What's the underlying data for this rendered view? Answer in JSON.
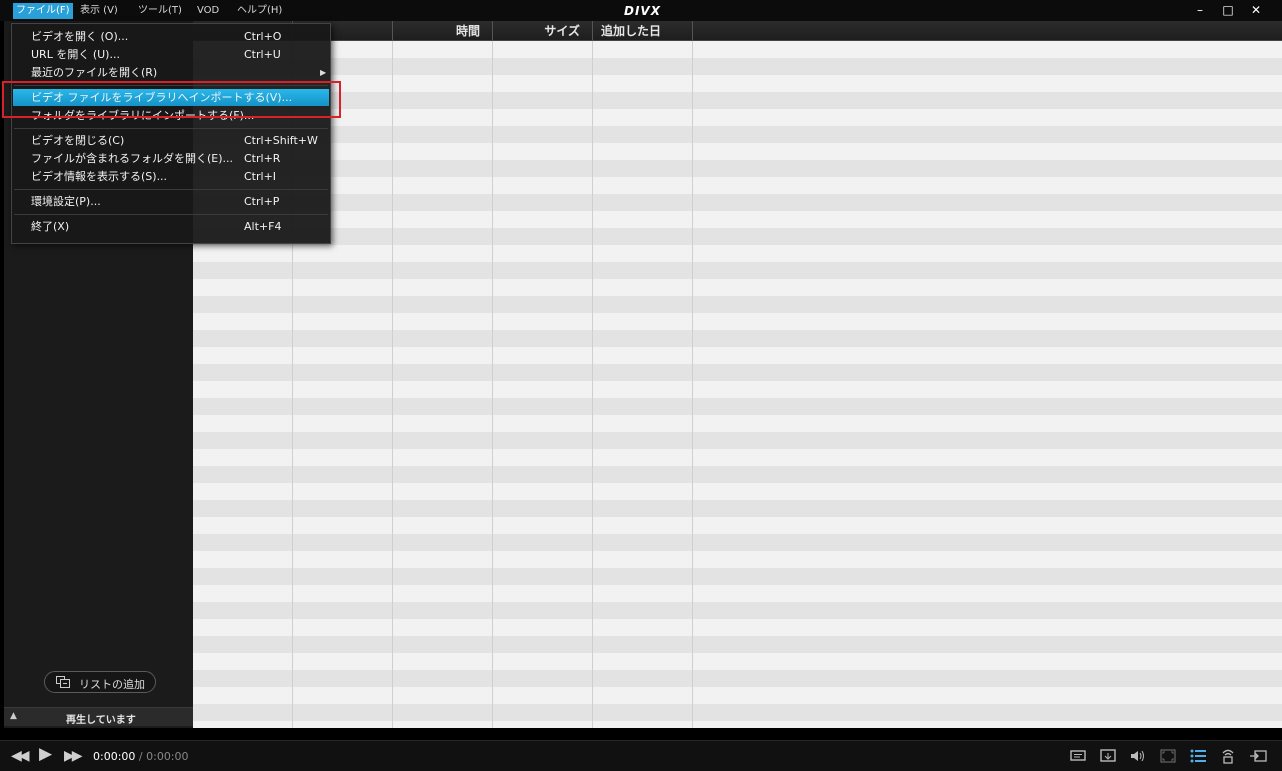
{
  "menubar": {
    "file": "ファイル(F)",
    "view": "表示 (V)",
    "tools": "ツール(T)",
    "vod": "VOD",
    "help": "ヘルプ(H)"
  },
  "app": {
    "logo": "DIVX"
  },
  "window_controls": {
    "minimize": "–",
    "maximize": "□",
    "close": "✕"
  },
  "table": {
    "columns": [
      "",
      "",
      "時間",
      "サイズ",
      "追加した日"
    ]
  },
  "sidebar": {
    "add_list_label": "リストの追加",
    "now_playing_label": "再生しています",
    "collapse_glyph": "▲"
  },
  "file_menu": {
    "items": [
      {
        "label": "ビデオを開く (O)...",
        "shortcut": "Ctrl+O"
      },
      {
        "label": "URL を開く (U)...",
        "shortcut": "Ctrl+U"
      },
      {
        "label": "最近のファイルを開く(R)",
        "shortcut": "",
        "submenu": "▶"
      },
      {
        "label": "ビデオ ファイルをライブラリへインポートする(V)...",
        "shortcut": ""
      },
      {
        "label": "フォルダをライブラリにインポートする(F)...",
        "shortcut": ""
      },
      {
        "label": "ビデオを閉じる(C)",
        "shortcut": "Ctrl+Shift+W"
      },
      {
        "label": "ファイルが含まれるフォルダを開く(E)...",
        "shortcut": "Ctrl+R"
      },
      {
        "label": "ビデオ情報を表示する(S)...",
        "shortcut": "Ctrl+I"
      },
      {
        "label": "環境設定(P)...",
        "shortcut": "Ctrl+P"
      },
      {
        "label": "終了(X)",
        "shortcut": "Alt+F4"
      }
    ]
  },
  "player": {
    "current_time": "0:00:00",
    "separator": " / ",
    "total_time": "0:00:00",
    "prev_glyph": "◀◀",
    "play_glyph": "▶",
    "next_glyph": "▶▶"
  },
  "colors": {
    "highlight": "#1aa3d8",
    "annotation_box": "#d8222a",
    "menu_active": "#2aa0d8"
  }
}
